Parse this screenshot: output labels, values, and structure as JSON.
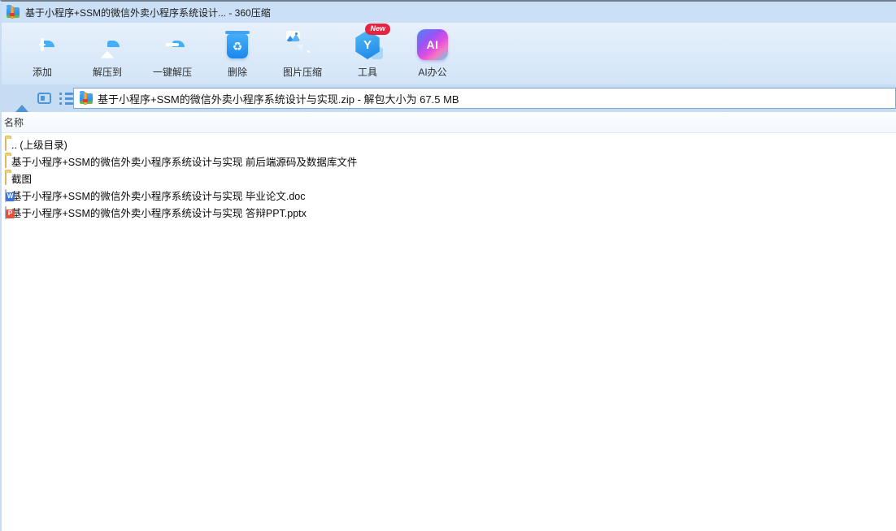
{
  "window": {
    "title": "基于小程序+SSM的微信外卖小程序系统设计... - 360压缩"
  },
  "toolbar": {
    "items": [
      {
        "id": "add",
        "label": "添加",
        "icon": "add-folder-icon",
        "badge": ""
      },
      {
        "id": "extract-to",
        "label": "解压到",
        "icon": "extract-folder-icon",
        "badge": ""
      },
      {
        "id": "one-click-extract",
        "label": "一键解压",
        "icon": "one-click-extract-icon",
        "badge": ""
      },
      {
        "id": "delete",
        "label": "删除",
        "icon": "delete-trash-icon",
        "badge": ""
      },
      {
        "id": "image-compress",
        "label": "图片压缩",
        "icon": "image-compress-icon",
        "badge": ""
      },
      {
        "id": "tools",
        "label": "工具",
        "icon": "tools-hexagon-icon",
        "badge": "New"
      },
      {
        "id": "ai-office",
        "label": "AI办公",
        "icon": "ai-office-icon",
        "badge": ""
      }
    ]
  },
  "address_row": {
    "path_text": "基于小程序+SSM的微信外卖小程序系统设计与实现.zip - 解包大小为 67.5 MB",
    "nav_icons": [
      "up-icon",
      "preview-pane-icon",
      "list-view-icon"
    ]
  },
  "file_list": {
    "name_column": "名称",
    "rows": [
      {
        "name": ".. (上级目录)",
        "type": "folder",
        "icon": "folder-icon"
      },
      {
        "name": "基于小程序+SSM的微信外卖小程序系统设计与实现 前后端源码及数据库文件",
        "type": "folder",
        "icon": "folder-icon"
      },
      {
        "name": "截图",
        "type": "folder",
        "icon": "folder-icon"
      },
      {
        "name": "基于小程序+SSM的微信外卖小程序系统设计与实现 毕业论文.doc",
        "type": "doc",
        "icon": "word-doc-icon"
      },
      {
        "name": "基于小程序+SSM的微信外卖小程序系统设计与实现 答辩PPT.pptx",
        "type": "ppt",
        "icon": "ppt-icon"
      }
    ]
  },
  "icon_glyphs": {
    "tools": "Y",
    "ai": "AI",
    "word": "W",
    "ppt": "P",
    "recycle": "♻"
  },
  "colors": {
    "titlebar_bg": "#cbe0f6",
    "toolbar_bg_top": "#e7f0fb",
    "toolbar_bg_bottom": "#d2e5f8",
    "address_row_bg": "#c5dcf3",
    "accent_blue": "#1d87ea",
    "nav_icon_blue": "#4f93d8",
    "badge_red": "#e8233f",
    "folder_yellow": "#f3d474",
    "zip_zipper_orange": "#f6a83b"
  }
}
